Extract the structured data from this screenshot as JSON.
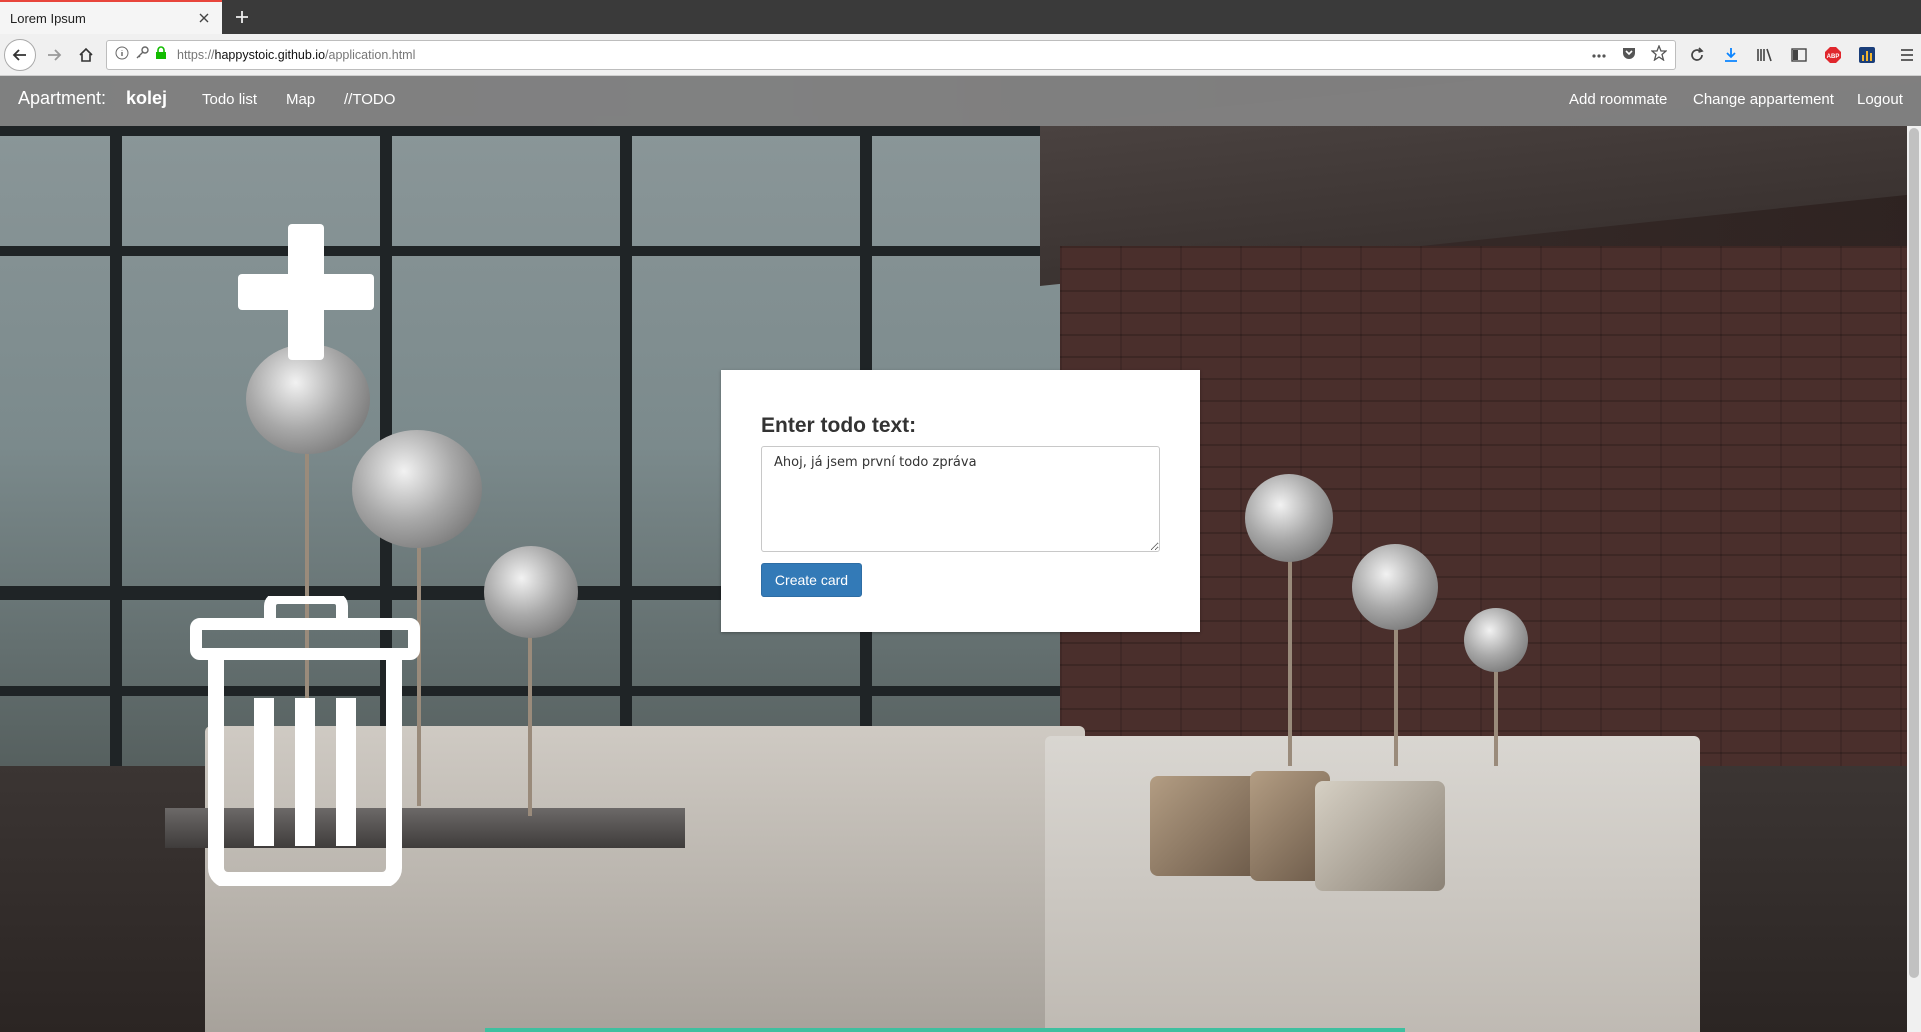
{
  "browser": {
    "tab_title": "Lorem Ipsum",
    "url_prefix": "https://",
    "url_host": "happystoic.github.io",
    "url_path": "/application.html",
    "icons": [
      "info-icon",
      "key-icon",
      "lock-icon",
      "more-icon",
      "pocket-icon",
      "bookmark-star-icon",
      "reload-icon",
      "download-icon",
      "library-icon",
      "sidebar-icon",
      "adblock-icon",
      "extension-icon",
      "menu-icon"
    ]
  },
  "app": {
    "brand_label": "Apartment:",
    "brand_name": "kolej",
    "nav_left": [
      "Todo list",
      "Map",
      "//TODO"
    ],
    "nav_right": [
      "Add roommate",
      "Change appartement",
      "Logout"
    ]
  },
  "dialog": {
    "title": "Enter todo text:",
    "input_value": "Ahoj, já jsem první todo zpráva",
    "button_label": "Create card"
  },
  "colors": {
    "accent": "#337ab7",
    "navbar": "#828282",
    "tab_accent": "#e8453c"
  }
}
